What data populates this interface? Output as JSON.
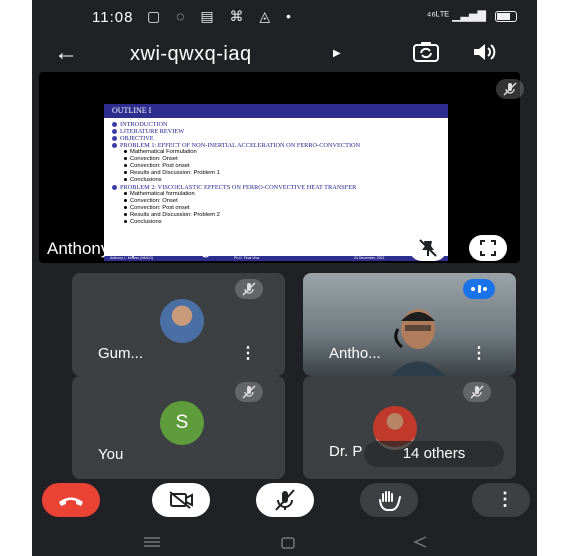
{
  "status_bar": {
    "time": "11:08",
    "right_text": "⁴⁶ᴸᵀᴱ"
  },
  "header": {
    "meeting_code": "xwi-qwxq-iaq"
  },
  "presentation": {
    "presenting_label": "Anthony is presenting",
    "slide": {
      "header": "OUTLINE I",
      "items": [
        {
          "text": "INTRODUCTION",
          "level": 1
        },
        {
          "text": "LITERATURE REVIEW",
          "level": 1
        },
        {
          "text": "OBJECTIVE",
          "level": 1
        },
        {
          "text": "PROBLEM 1: EFFECT OF NON-INERTIAL ACCELERATION ON FERRO-CONVECTION",
          "level": 1
        },
        {
          "text": "Mathematical Formulation",
          "level": 2
        },
        {
          "text": "Convection: Onset",
          "level": 2
        },
        {
          "text": "Convection: Post onset",
          "level": 2
        },
        {
          "text": "Results and Discussion: Problem 1",
          "level": 2
        },
        {
          "text": "Conclusions",
          "level": 2
        },
        {
          "text": "PROBLEM 2: VISCOELASTIC EFFECTS ON FERRO-CONVECTIVE HEAT TRANSFER",
          "level": 1
        },
        {
          "text": "Mathematical formulation",
          "level": 2
        },
        {
          "text": "Convection: Onset",
          "level": 2
        },
        {
          "text": "Convection: Post onset",
          "level": 2
        },
        {
          "text": "Results and Discussion: Problem 2",
          "level": 2
        },
        {
          "text": "Conclusions",
          "level": 2
        }
      ],
      "footer": {
        "left": "Anthony L. Mrovsn (NMCG)",
        "center": "Ph.D. Final Viva",
        "right": "24 December, 2021",
        "page": "2 / 101"
      }
    }
  },
  "participants": [
    {
      "name": "Gum...",
      "avatar_type": "photo"
    },
    {
      "name": "Antho...",
      "avatar_type": "video"
    },
    {
      "name": "You",
      "avatar_type": "letter",
      "initial": "S",
      "avatar_color": "#5e9c3c"
    },
    {
      "name": "Dr. P",
      "avatar_type": "photo"
    }
  ],
  "others_label": "14 others",
  "colors": {
    "background": "#202124",
    "tile": "#3c4043",
    "end_call": "#ea4335",
    "speaking_indicator": "#1a73e8"
  },
  "icons": {
    "back": "arrow-left-icon",
    "camera_switch": "camera-switch-icon",
    "speaker": "speaker-icon",
    "mic_off": "mic-off-icon",
    "pin_off": "pin-off-icon",
    "fullscreen": "fullscreen-icon",
    "end_call": "phone-hangup-icon",
    "camera_off": "camera-off-icon",
    "raise_hand": "hand-icon",
    "more": "more-vertical-icon"
  }
}
